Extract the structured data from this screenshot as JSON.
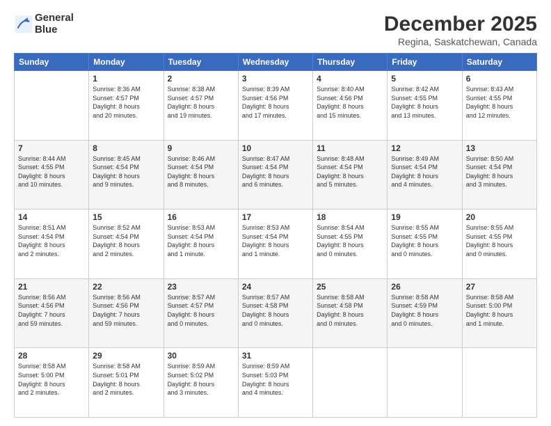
{
  "logo": {
    "line1": "General",
    "line2": "Blue"
  },
  "title": "December 2025",
  "subtitle": "Regina, Saskatchewan, Canada",
  "weekdays": [
    "Sunday",
    "Monday",
    "Tuesday",
    "Wednesday",
    "Thursday",
    "Friday",
    "Saturday"
  ],
  "weeks": [
    [
      {
        "day": "",
        "info": ""
      },
      {
        "day": "1",
        "info": "Sunrise: 8:36 AM\nSunset: 4:57 PM\nDaylight: 8 hours\nand 20 minutes."
      },
      {
        "day": "2",
        "info": "Sunrise: 8:38 AM\nSunset: 4:57 PM\nDaylight: 8 hours\nand 19 minutes."
      },
      {
        "day": "3",
        "info": "Sunrise: 8:39 AM\nSunset: 4:56 PM\nDaylight: 8 hours\nand 17 minutes."
      },
      {
        "day": "4",
        "info": "Sunrise: 8:40 AM\nSunset: 4:56 PM\nDaylight: 8 hours\nand 15 minutes."
      },
      {
        "day": "5",
        "info": "Sunrise: 8:42 AM\nSunset: 4:55 PM\nDaylight: 8 hours\nand 13 minutes."
      },
      {
        "day": "6",
        "info": "Sunrise: 8:43 AM\nSunset: 4:55 PM\nDaylight: 8 hours\nand 12 minutes."
      }
    ],
    [
      {
        "day": "7",
        "info": "Sunrise: 8:44 AM\nSunset: 4:55 PM\nDaylight: 8 hours\nand 10 minutes."
      },
      {
        "day": "8",
        "info": "Sunrise: 8:45 AM\nSunset: 4:54 PM\nDaylight: 8 hours\nand 9 minutes."
      },
      {
        "day": "9",
        "info": "Sunrise: 8:46 AM\nSunset: 4:54 PM\nDaylight: 8 hours\nand 8 minutes."
      },
      {
        "day": "10",
        "info": "Sunrise: 8:47 AM\nSunset: 4:54 PM\nDaylight: 8 hours\nand 6 minutes."
      },
      {
        "day": "11",
        "info": "Sunrise: 8:48 AM\nSunset: 4:54 PM\nDaylight: 8 hours\nand 5 minutes."
      },
      {
        "day": "12",
        "info": "Sunrise: 8:49 AM\nSunset: 4:54 PM\nDaylight: 8 hours\nand 4 minutes."
      },
      {
        "day": "13",
        "info": "Sunrise: 8:50 AM\nSunset: 4:54 PM\nDaylight: 8 hours\nand 3 minutes."
      }
    ],
    [
      {
        "day": "14",
        "info": "Sunrise: 8:51 AM\nSunset: 4:54 PM\nDaylight: 8 hours\nand 2 minutes."
      },
      {
        "day": "15",
        "info": "Sunrise: 8:52 AM\nSunset: 4:54 PM\nDaylight: 8 hours\nand 2 minutes."
      },
      {
        "day": "16",
        "info": "Sunrise: 8:53 AM\nSunset: 4:54 PM\nDaylight: 8 hours\nand 1 minute."
      },
      {
        "day": "17",
        "info": "Sunrise: 8:53 AM\nSunset: 4:54 PM\nDaylight: 8 hours\nand 1 minute."
      },
      {
        "day": "18",
        "info": "Sunrise: 8:54 AM\nSunset: 4:55 PM\nDaylight: 8 hours\nand 0 minutes."
      },
      {
        "day": "19",
        "info": "Sunrise: 8:55 AM\nSunset: 4:55 PM\nDaylight: 8 hours\nand 0 minutes."
      },
      {
        "day": "20",
        "info": "Sunrise: 8:55 AM\nSunset: 4:55 PM\nDaylight: 8 hours\nand 0 minutes."
      }
    ],
    [
      {
        "day": "21",
        "info": "Sunrise: 8:56 AM\nSunset: 4:56 PM\nDaylight: 7 hours\nand 59 minutes."
      },
      {
        "day": "22",
        "info": "Sunrise: 8:56 AM\nSunset: 4:56 PM\nDaylight: 7 hours\nand 59 minutes."
      },
      {
        "day": "23",
        "info": "Sunrise: 8:57 AM\nSunset: 4:57 PM\nDaylight: 8 hours\nand 0 minutes."
      },
      {
        "day": "24",
        "info": "Sunrise: 8:57 AM\nSunset: 4:58 PM\nDaylight: 8 hours\nand 0 minutes."
      },
      {
        "day": "25",
        "info": "Sunrise: 8:58 AM\nSunset: 4:58 PM\nDaylight: 8 hours\nand 0 minutes."
      },
      {
        "day": "26",
        "info": "Sunrise: 8:58 AM\nSunset: 4:59 PM\nDaylight: 8 hours\nand 0 minutes."
      },
      {
        "day": "27",
        "info": "Sunrise: 8:58 AM\nSunset: 5:00 PM\nDaylight: 8 hours\nand 1 minute."
      }
    ],
    [
      {
        "day": "28",
        "info": "Sunrise: 8:58 AM\nSunset: 5:00 PM\nDaylight: 8 hours\nand 2 minutes."
      },
      {
        "day": "29",
        "info": "Sunrise: 8:58 AM\nSunset: 5:01 PM\nDaylight: 8 hours\nand 2 minutes."
      },
      {
        "day": "30",
        "info": "Sunrise: 8:59 AM\nSunset: 5:02 PM\nDaylight: 8 hours\nand 3 minutes."
      },
      {
        "day": "31",
        "info": "Sunrise: 8:59 AM\nSunset: 5:03 PM\nDaylight: 8 hours\nand 4 minutes."
      },
      {
        "day": "",
        "info": ""
      },
      {
        "day": "",
        "info": ""
      },
      {
        "day": "",
        "info": ""
      }
    ]
  ]
}
